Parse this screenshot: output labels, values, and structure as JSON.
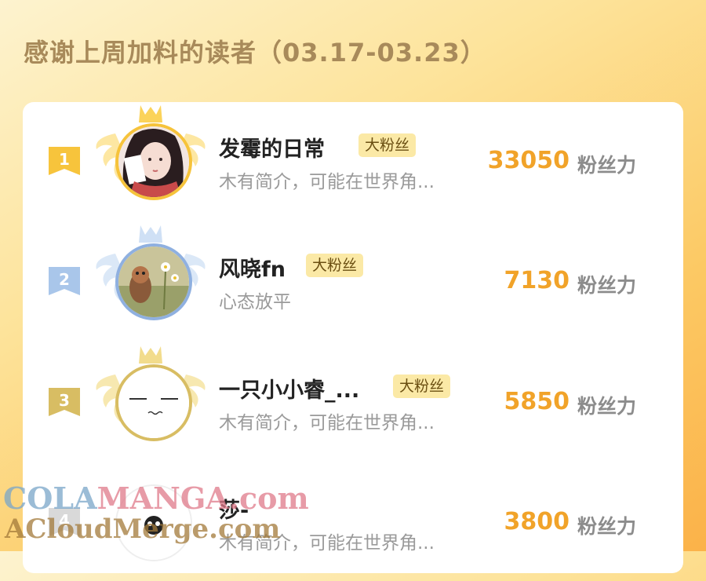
{
  "title": "感谢上周加料的读者（03.17-03.23）",
  "badge_label": "大粉丝",
  "score_unit": "粉丝力",
  "colors": {
    "accent": "#f1a329",
    "gold": "#f7c43c",
    "silver": "#a9c6ea",
    "bronze": "#d8bd63",
    "badge_bg": "#fbe9a6"
  },
  "readers": [
    {
      "rank": "1",
      "name": "发霉的日常",
      "bio": "木有简介，可能在世界角...",
      "score": "33050",
      "show_badge": true
    },
    {
      "rank": "2",
      "name": "风晓fn",
      "bio": "心态放平",
      "score": "7130",
      "show_badge": true
    },
    {
      "rank": "3",
      "name": "一只小小睿_...",
      "bio": "木有简介，可能在世界角...",
      "score": "5850",
      "show_badge": true
    },
    {
      "rank": "4",
      "name": "莎-",
      "bio": "木有简介，可能在世界角...",
      "score": "3800",
      "show_badge": false
    }
  ],
  "watermark": {
    "line1a": "COLA",
    "line1b": "MANGA.com",
    "line2": "ACloudMerge.com"
  }
}
